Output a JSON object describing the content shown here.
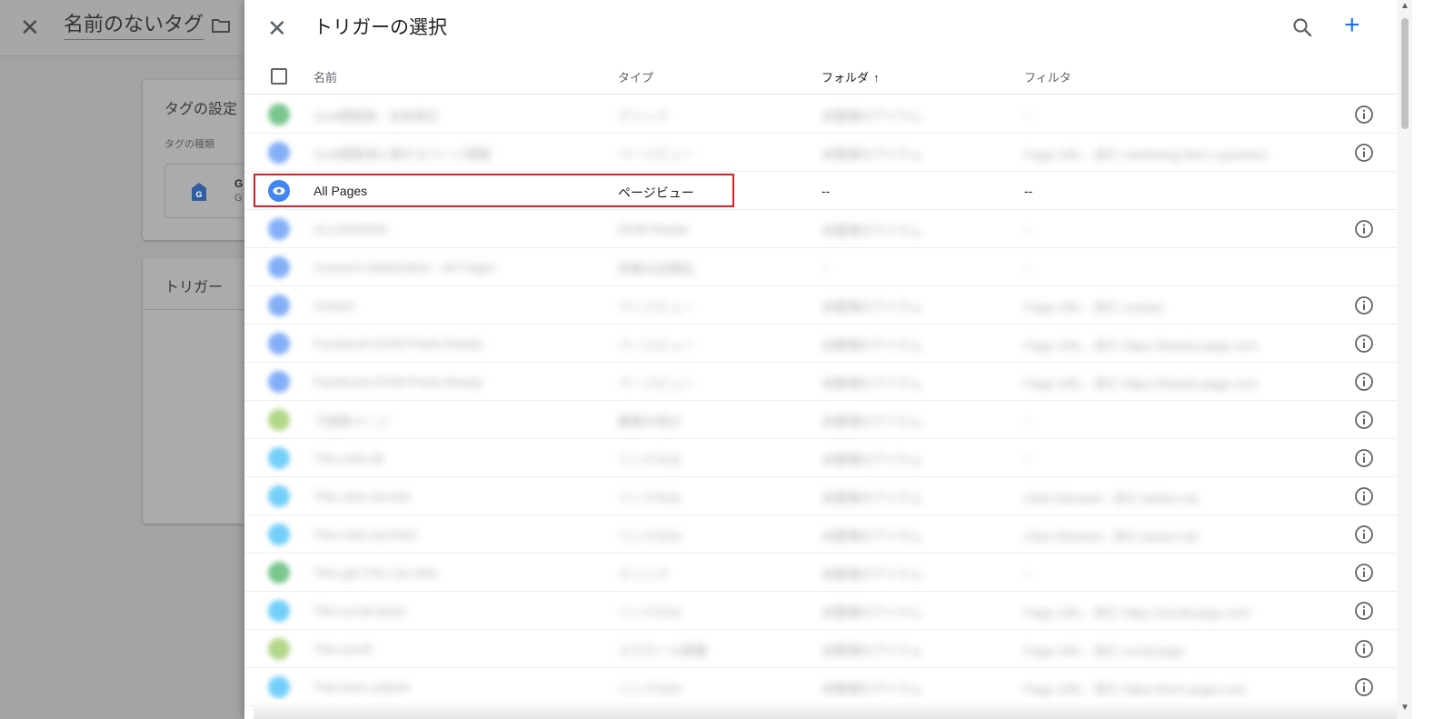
{
  "background": {
    "close_icon": "close-icon",
    "tag_title": "名前のないタグ",
    "folder_icon": "folder-icon",
    "tag_config_card": {
      "title": "タグの設定",
      "type_label": "タグの種類",
      "type_initial": "G",
      "type_initial_sub": "G"
    },
    "trigger_card": {
      "title": "トリガー"
    }
  },
  "panel": {
    "title": "トリガーの選択",
    "close_icon": "close-icon",
    "search_icon": "search-icon",
    "add_label": "+",
    "columns": {
      "name": "名前",
      "type": "タイプ",
      "folder": "フォルダ",
      "folder_sort": "↑",
      "filter": "フィルタ"
    },
    "rows": [
      {
        "name": "GA4閲覧数 - 全体表示",
        "type": "クリック",
        "folder": "未整理のアイテム",
        "filter": "--",
        "icon_color": "#34a853",
        "blur": true
      },
      {
        "name": "GA4閲覧用に関するページ閲覧",
        "type": "ページビュー",
        "folder": "未整理のアイテム",
        "filter": "Page URL - 含む marketing.html x.question",
        "icon_color": "#4285f4",
        "blur": true
      },
      {
        "name": "All Pages",
        "type": "ページビュー",
        "folder": "--",
        "filter": "--",
        "icon_color": "#4285f4",
        "blur": false,
        "highlight": true
      },
      {
        "name": "ALLDOMAIN",
        "type": "DOM Ready",
        "folder": "未整理のアイテム",
        "filter": "--",
        "icon_color": "#4285f4",
        "blur": true
      },
      {
        "name": "Consent Initialization - All Pages",
        "type": "同意の初期化",
        "folder": "--",
        "filter": "--",
        "icon_color": "#4285f4",
        "blur": true
      },
      {
        "name": "contact",
        "type": "ページビュー",
        "folder": "未整理のアイテム",
        "filter": "Page URL - 含む contact",
        "icon_color": "#4285f4",
        "blur": true
      },
      {
        "name": "Facebook-DOM-Pixels-Ready",
        "type": "ページビュー",
        "folder": "未整理のアイテム",
        "filter": "Page URL - 含む https://thanks.page.com",
        "icon_color": "#4285f4",
        "blur": true
      },
      {
        "name": "Facebook-DOM-Pixels-Ready",
        "type": "ページビュー",
        "folder": "未整理のアイテム",
        "filter": "Page URL - 含む https://thanks.page.com",
        "icon_color": "#4285f4",
        "blur": true
      },
      {
        "name": "下部数ページ",
        "type": "要素の表示",
        "folder": "未整理のアイテム",
        "filter": "--",
        "icon_color": "#8bc34a",
        "blur": true
      },
      {
        "name": "Trko.click.all",
        "type": "リンクのみ",
        "folder": "未整理のアイテム",
        "filter": "--",
        "icon_color": "#29b6f6",
        "blur": true
      },
      {
        "name": "Trko.click.cta.link",
        "type": "リンクのみ",
        "folder": "未整理のアイテム",
        "filter": "Click Element - 含む button.cta",
        "icon_color": "#29b6f6",
        "blur": true
      },
      {
        "name": "Trko.click.cta.link2",
        "type": "リンクのみ",
        "folder": "未整理のアイテム",
        "filter": "Click Element - 含む button.cta",
        "icon_color": "#29b6f6",
        "blur": true
      },
      {
        "name": "Trko.get.Trko.cta.click",
        "type": "クリック",
        "folder": "未整理のアイテム",
        "filter": "--",
        "icon_color": "#34a853",
        "blur": true
      },
      {
        "name": "Trko.scroll.down",
        "type": "リンクのみ",
        "folder": "未整理のアイテム",
        "filter": "Page URL - 含む https://scroll.page.com",
        "icon_color": "#29b6f6",
        "blur": true
      },
      {
        "name": "Trko.scroll",
        "type": "スクロール距離",
        "folder": "未整理のアイテム",
        "filter": "Page URL - 含む scroll.page",
        "icon_color": "#8bc34a",
        "blur": true
      },
      {
        "name": "Trko.form.submit",
        "type": "リンクのみ",
        "folder": "未整理のアイテム",
        "filter": "Page URL - 含む https://form.page.com",
        "icon_color": "#29b6f6",
        "blur": true
      }
    ],
    "info_rows": [
      true,
      true,
      false,
      true,
      false,
      true,
      true,
      true,
      true,
      true,
      true,
      true,
      true,
      true,
      true,
      true
    ]
  },
  "colors": {
    "accent": "#1a73e8",
    "highlight_border": "#e01b22",
    "pageview_icon": "#4285f4"
  }
}
